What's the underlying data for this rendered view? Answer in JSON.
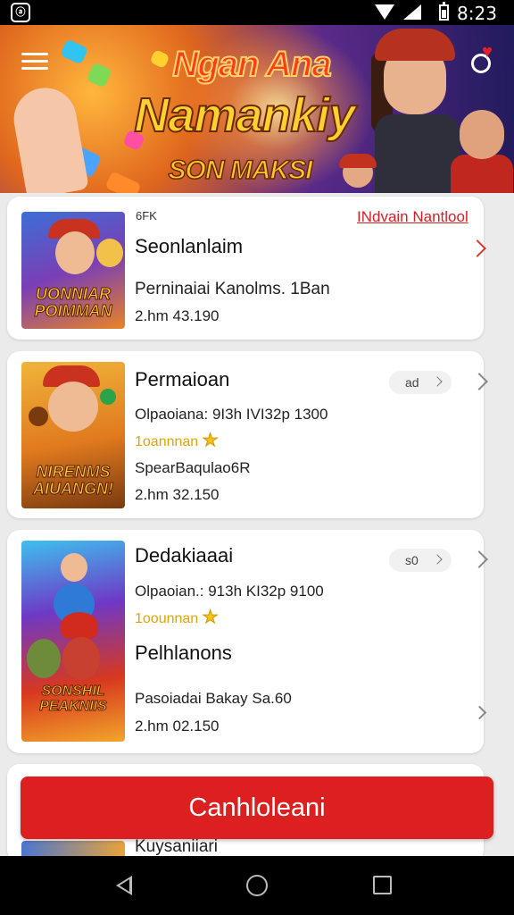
{
  "status_bar": {
    "time": "8:23",
    "left_icon": "app-notification-icon"
  },
  "banner": {
    "title_line1": "Ngan Ana",
    "title_line2": "Namankiy",
    "title_line3": "SON MAKSI",
    "menu_icon": "hamburger-menu-icon",
    "profile_icon": "profile-heart-icon"
  },
  "cards": [
    {
      "small_label": "6FK",
      "link": "INdvain Nantlool",
      "title": "Seonlanlaim",
      "description": "Perninaiai Kanolms. 1Ban",
      "meta": "2.hm 43.190",
      "thumb_caption": "UONNIAR POIMMAN"
    },
    {
      "title": "Permaioan",
      "pill": "ad",
      "info": "Olpaoiana: 9I3h IVI32p 1300",
      "rating_label": "1oannnan",
      "subtitle": "SpearBaqulao6R",
      "meta": "2.hm 32.150",
      "thumb_caption": "NIRENMS AIUANGN!"
    },
    {
      "title": "Dedakiaaai",
      "pill": "s0",
      "info": "Olpaoian.: 913h KI32p 9100",
      "rating_label": "1oounnan",
      "subtitle": "Pelhlanons",
      "description": "Pasoiadai Bakay Sa.60",
      "meta": "2.hm 02.150",
      "thumb_caption": "SONSHIL PEAKNIIS"
    },
    {
      "partial_text": "Kuysaniiari"
    }
  ],
  "cta_button": {
    "label": "Canhloleani"
  },
  "colors": {
    "accent_red": "#dc1f1f",
    "rating_gold": "#e3a400",
    "link_red": "#d61f26"
  }
}
